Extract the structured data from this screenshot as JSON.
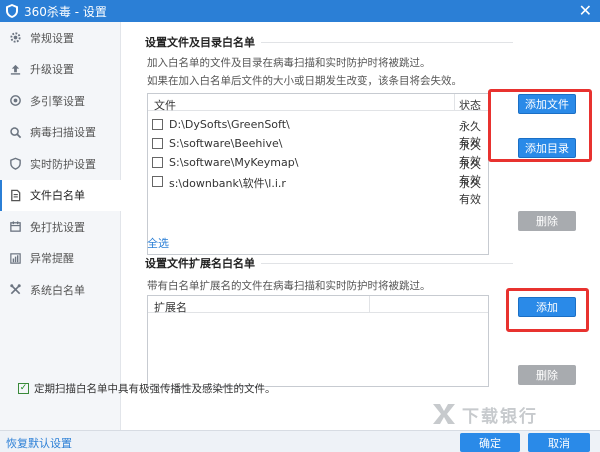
{
  "window": {
    "title": "360杀毒 - 设置"
  },
  "sidebar": {
    "items": [
      {
        "label": "常规设置",
        "icon": "gear-icon"
      },
      {
        "label": "升级设置",
        "icon": "upload-icon"
      },
      {
        "label": "多引擎设置",
        "icon": "engine-icon"
      },
      {
        "label": "病毒扫描设置",
        "icon": "search-icon"
      },
      {
        "label": "实时防护设置",
        "icon": "shield-icon"
      },
      {
        "label": "文件白名单",
        "icon": "document-icon",
        "active": true
      },
      {
        "label": "免打扰设置",
        "icon": "calendar-icon"
      },
      {
        "label": "异常提醒",
        "icon": "bar-chart-icon"
      },
      {
        "label": "系统白名单",
        "icon": "tools-icon"
      }
    ]
  },
  "whitelist": {
    "title": "设置文件及目录白名单",
    "desc1": "加入白名单的文件及目录在病毒扫描和实时防护时将被跳过。",
    "desc2": "如果在加入白名单后文件的大小或日期发生改变，该条目将会失效。",
    "col_file": "文件",
    "col_status": "状态",
    "rows": [
      {
        "path": "D:\\DySofts\\GreenSoft\\",
        "status": "永久有效"
      },
      {
        "path": "S:\\software\\Beehive\\",
        "status": "永久有效"
      },
      {
        "path": "S:\\software\\MyKeymap\\",
        "status": "永久有效"
      },
      {
        "path": "s:\\downbank\\软件\\l.i.r",
        "status": "永久有效"
      }
    ],
    "btn_add_file": "添加文件",
    "btn_add_dir": "添加目录",
    "btn_delete": "删除",
    "select_all": "全选"
  },
  "ext_whitelist": {
    "title": "设置文件扩展名白名单",
    "desc": "带有白名单扩展名的文件在病毒扫描和实时防护时将被跳过。",
    "col_ext": "扩展名",
    "btn_add": "添加",
    "btn_delete": "删除"
  },
  "option": {
    "label": "定期扫描白名单中具有极强传播性及感染性的文件。",
    "checked": true
  },
  "footer": {
    "restore": "恢复默认设置",
    "ok": "确定",
    "cancel": "取消"
  },
  "watermark": {
    "text": "下载银行"
  },
  "colors": {
    "accent": "#2a8ae8",
    "highlight": "#e8322f",
    "disabled": "#a8abaf"
  }
}
